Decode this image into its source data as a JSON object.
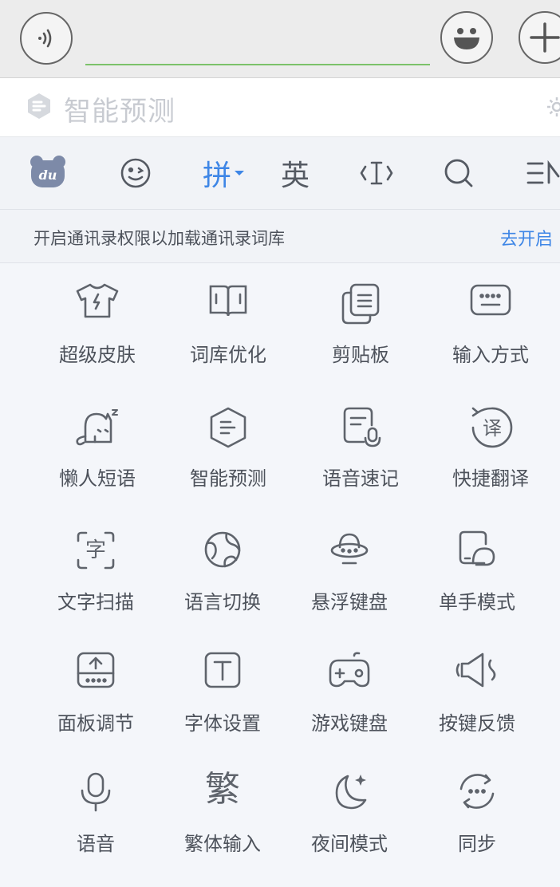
{
  "input_bar": {
    "text_value": "",
    "voice_icon": "voice-wave-icon",
    "emoji_icon": "smiley-icon",
    "plus_icon": "plus-icon"
  },
  "prediction_bar": {
    "label": "智能预测",
    "logo_icon": "prediction-logo-icon",
    "settings_icon": "gear-icon"
  },
  "toolbar": {
    "items": [
      {
        "icon": "du-logo-icon"
      },
      {
        "icon": "emoji-wink-icon"
      },
      {
        "label": "拼"
      },
      {
        "label": "英"
      },
      {
        "icon": "text-cursor-icon"
      },
      {
        "icon": "search-icon"
      },
      {
        "icon": "menu-icon"
      }
    ]
  },
  "banner": {
    "text": "开启通讯录权限以加载通讯录词库",
    "link": "去开启"
  },
  "grid": {
    "items": [
      {
        "label": "超级皮肤",
        "icon": "skin-shirt-icon"
      },
      {
        "label": "词库优化",
        "icon": "book-icon"
      },
      {
        "label": "剪贴板",
        "icon": "clipboard-icon"
      },
      {
        "label": "输入方式",
        "icon": "keyboard-icon"
      },
      {
        "label": "懒人短语",
        "icon": "lazy-cat-icon"
      },
      {
        "label": "智能预测",
        "icon": "hexagon-predict-icon"
      },
      {
        "label": "语音速记",
        "icon": "voice-note-icon"
      },
      {
        "label": "快捷翻译",
        "icon": "translate-icon"
      },
      {
        "label": "文字扫描",
        "icon": "text-scan-icon"
      },
      {
        "label": "语言切换",
        "icon": "globe-icon"
      },
      {
        "label": "悬浮键盘",
        "icon": "ufo-icon"
      },
      {
        "label": "单手模式",
        "icon": "one-hand-icon"
      },
      {
        "label": "面板调节",
        "icon": "panel-adjust-icon"
      },
      {
        "label": "字体设置",
        "icon": "font-icon"
      },
      {
        "label": "游戏键盘",
        "icon": "gamepad-icon"
      },
      {
        "label": "按键反馈",
        "icon": "speaker-icon"
      },
      {
        "label": "语音",
        "icon": "microphone-icon"
      },
      {
        "label": "繁体输入",
        "glyph": "繁"
      },
      {
        "label": "夜间模式",
        "icon": "moon-icon"
      },
      {
        "label": "同步",
        "icon": "sync-icon"
      }
    ]
  },
  "colors": {
    "accent": "#3e86e6",
    "input_underline": "#7cc26a",
    "icon_stroke": "#5f646c",
    "background": "#f1f3f7"
  }
}
